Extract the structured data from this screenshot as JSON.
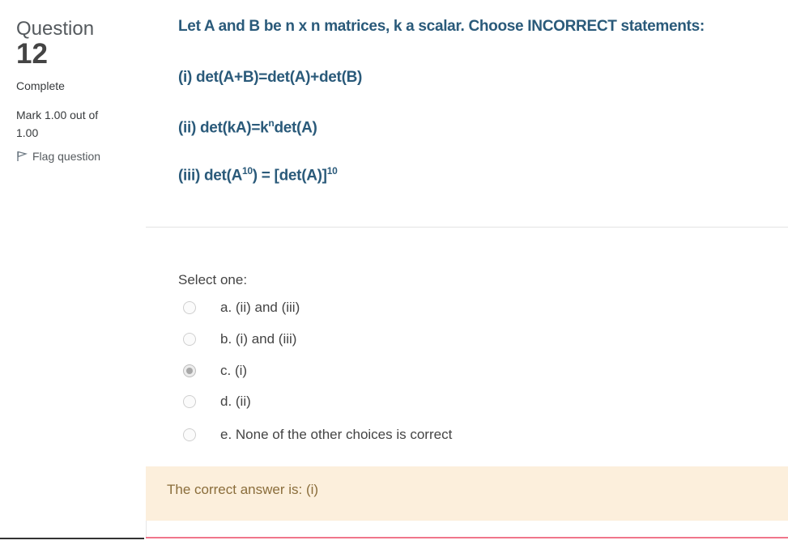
{
  "info": {
    "question_word": "Question",
    "question_number": "12",
    "state": "Complete",
    "grade": "Mark 1.00 out of 1.00",
    "flag_label": "Flag question"
  },
  "question": {
    "line1": "Let A and B be n x n matrices, k a scalar. Choose INCORRECT statements:",
    "line2": "(i) det(A+B)=det(A)+det(B)",
    "line3_pre": "(ii) det(kA)=k",
    "line3_sup": "n",
    "line3_post": "det(A)",
    "line4_a": "(iii) det(A",
    "line4_sup1": "10",
    "line4_b": ") = [det(A)]",
    "line4_sup2": "10"
  },
  "answer": {
    "prompt": "Select one:",
    "options": [
      {
        "label": "a. (ii) and (iii)",
        "checked": false
      },
      {
        "label": "b. (i) and (iii)",
        "checked": false
      },
      {
        "label": "c. (i)",
        "checked": true
      },
      {
        "label": "d. (ii)",
        "checked": false
      },
      {
        "label": "e. None of the other choices is correct",
        "checked": false
      }
    ]
  },
  "feedback": {
    "right_answer": "The correct answer is: (i)"
  },
  "colors": {
    "question_text": "#2a5a7a",
    "feedback_bg": "#fcefdc",
    "feedback_text": "#8a6d3b",
    "bottom_accent": "#f0768b"
  }
}
